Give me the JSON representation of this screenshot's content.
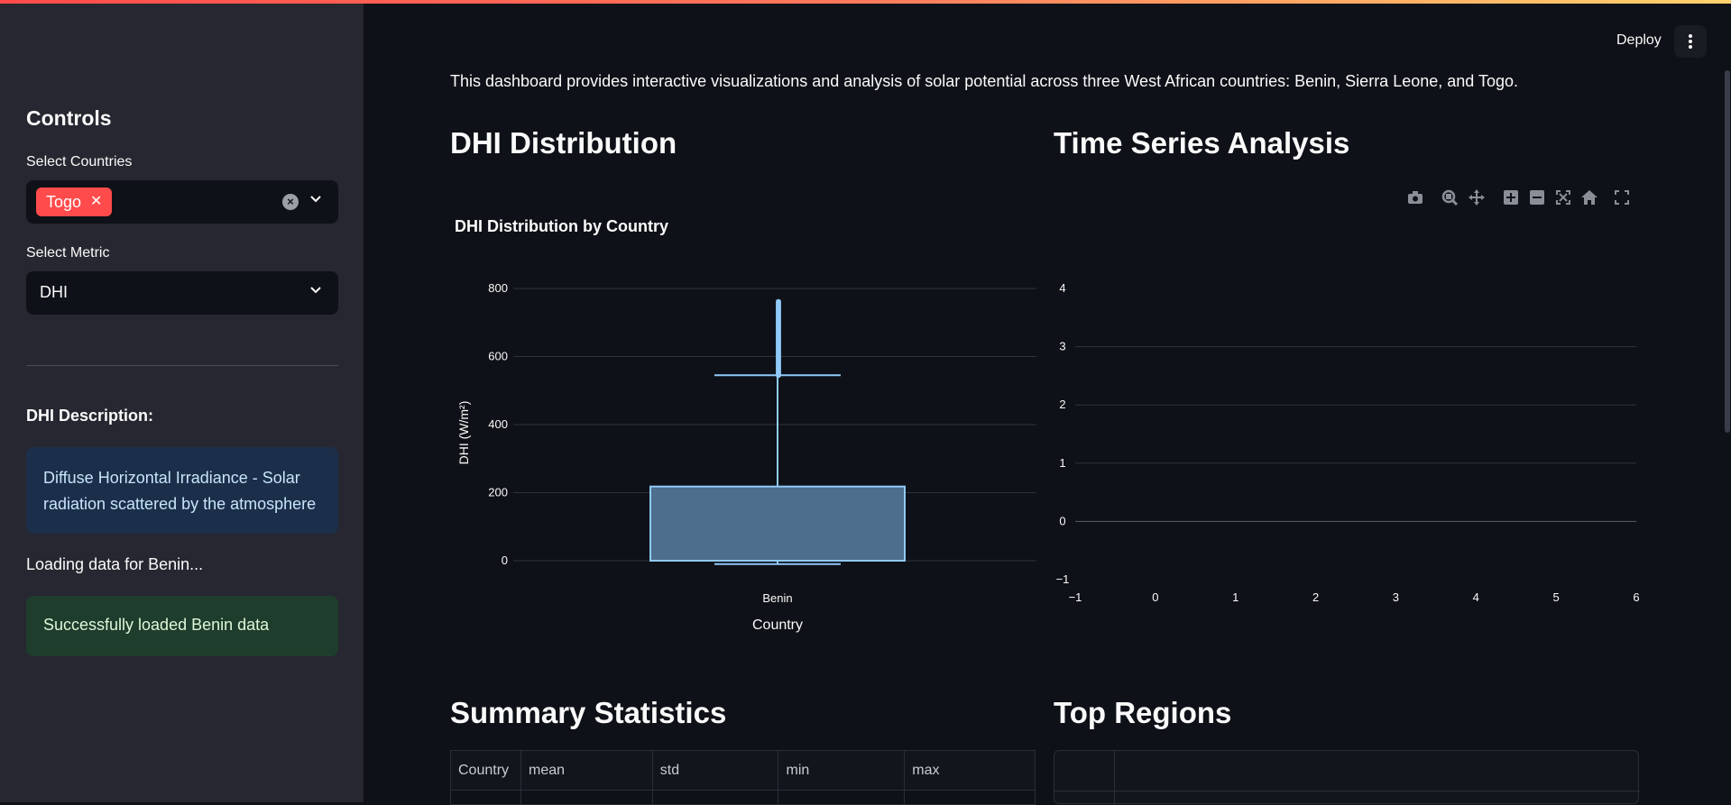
{
  "sidebar": {
    "title": "Controls",
    "countries_label": "Select Countries",
    "countries_selected": [
      "Togo"
    ],
    "metric_label": "Select Metric",
    "metric_value": "DHI",
    "description_title": "DHI Description:",
    "description_text": "Diffuse Horizontal Irradiance - Solar radiation scattered by the atmosphere",
    "loading_text": "Loading data for Benin...",
    "success_text": "Successfully loaded Benin data"
  },
  "header": {
    "deploy_label": "Deploy"
  },
  "main": {
    "intro": "This dashboard provides interactive visualizations and analysis of solar potential across three West African countries: Benin, Sierra Leone, and Togo.",
    "dist_heading": "DHI Distribution",
    "ts_heading": "Time Series Analysis",
    "stats_heading": "Summary Statistics",
    "regions_heading": "Top Regions",
    "stats_columns": [
      "Country",
      "mean",
      "std",
      "min",
      "max"
    ]
  },
  "colors": {
    "accent": "#ff4b4b",
    "box_fill": "#4e6e8e",
    "box_line": "#90caf9",
    "info_bg": "#1c2f4a",
    "success_bg": "#1f3d2c"
  },
  "chart_data": [
    {
      "type": "box",
      "title": "DHI Distribution by Country",
      "xlabel": "Country",
      "ylabel": "DHI (W/m²)",
      "categories": [
        "Benin"
      ],
      "yticks": [
        0,
        200,
        400,
        600,
        800
      ],
      "ylim": [
        -50,
        830
      ],
      "boxes": [
        {
          "category": "Benin",
          "min": -10,
          "q1": 0,
          "median": 0,
          "q3": 218,
          "upper_fence": 545,
          "outliers_range": [
            545,
            765
          ]
        }
      ]
    },
    {
      "type": "line",
      "title": "",
      "xticks": [
        -1,
        0,
        1,
        2,
        3,
        4,
        5,
        6
      ],
      "yticks": [
        -1,
        0,
        1,
        2,
        3,
        4
      ],
      "xlim": [
        -1,
        6
      ],
      "ylim": [
        -1,
        4
      ],
      "series": []
    }
  ],
  "modebar_icons": [
    "camera-icon",
    "zoom-icon",
    "pan-icon",
    "zoom-in-icon",
    "zoom-out-icon",
    "autoscale-icon",
    "reset-axes-icon",
    "fullscreen-icon"
  ]
}
